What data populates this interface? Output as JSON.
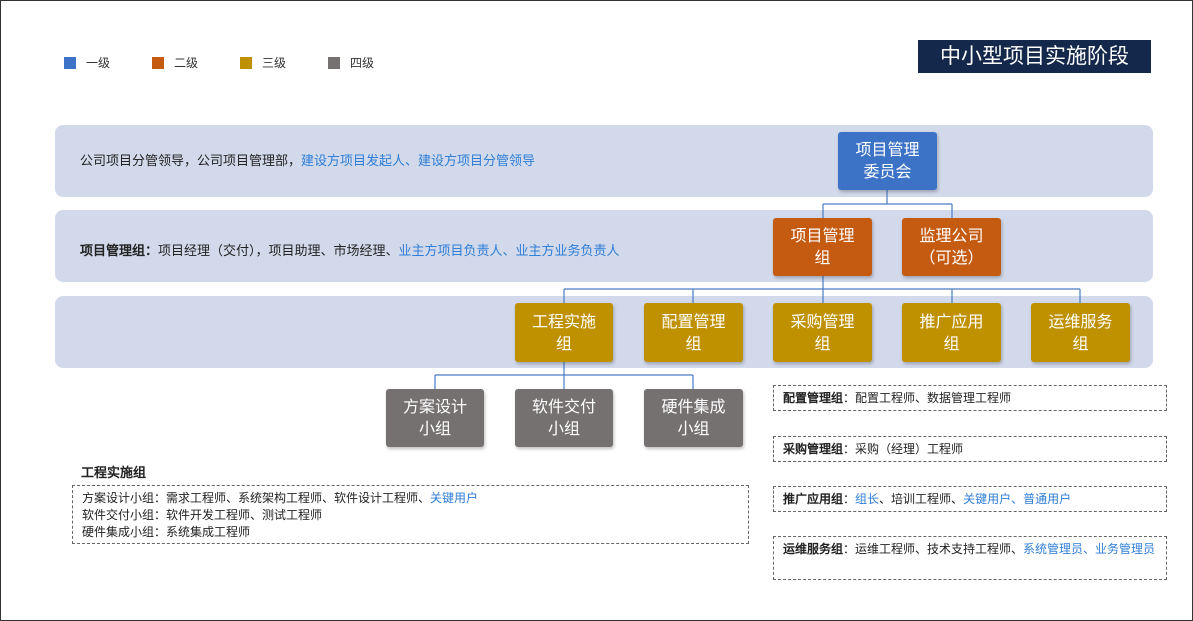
{
  "title": "中小型项目实施阶段",
  "legend": [
    {
      "label": "一级",
      "color": "#3d73c7"
    },
    {
      "label": "二级",
      "color": "#c55a11"
    },
    {
      "label": "三级",
      "color": "#bf9000"
    },
    {
      "label": "四级",
      "color": "#757171"
    }
  ],
  "bands": {
    "row1": {
      "text_black": "公司项目分管领导，公司项目管理部，",
      "text_blue": "建设方项目发起人、建设方项目分管领导"
    },
    "row2": {
      "label": "项目管理组：",
      "text_black": "项目经理（交付），项目助理、市场经理、",
      "text_blue": "业主方项目负责人、业主方业务负责人"
    }
  },
  "nodes": {
    "committee": {
      "line1": "项目管理",
      "line2": "委员会"
    },
    "pm_group": {
      "line1": "项目管理",
      "line2": "组"
    },
    "supervisor": {
      "line1": "监理公司",
      "line2": "（可选）"
    },
    "engineering": {
      "line1": "工程实施",
      "line2": "组"
    },
    "config": {
      "line1": "配置管理",
      "line2": "组"
    },
    "purchase": {
      "line1": "采购管理",
      "line2": "组"
    },
    "promotion": {
      "line1": "推广应用",
      "line2": "组"
    },
    "ops": {
      "line1": "运维服务",
      "line2": "组"
    },
    "design": {
      "line1": "方案设计",
      "line2": "小组"
    },
    "software": {
      "line1": "软件交付",
      "line2": "小组"
    },
    "hardware": {
      "line1": "硬件集成",
      "line2": "小组"
    }
  },
  "engineering_group": {
    "title": "工程实施组",
    "lines": [
      {
        "black": "方案设计小组：需求工程师、系统架构工程师、软件设计工程师、",
        "blue": "关键用户"
      },
      {
        "black": "软件交付小组：软件开发工程师、测试工程师",
        "blue": ""
      },
      {
        "black": "硬件集成小组：系统集成工程师",
        "blue": ""
      }
    ]
  },
  "group_notes": {
    "config": {
      "label": "配置管理组",
      "text_black": "：配置工程师、数据管理工程师",
      "text_blue": ""
    },
    "purchase": {
      "label": "采购管理组",
      "text_black": "：采购（经理）工程师",
      "text_blue": ""
    },
    "promotion": {
      "label": "推广应用组",
      "text_black": "：",
      "text_blue": "组长",
      "text_black2": "、培训工程师、",
      "text_blue2": "关键用户、普通用户"
    },
    "ops": {
      "label": "运维服务组",
      "text_black": "：运维工程师、技术支持工程师、",
      "text_blue": "系统管理员、业务管理员"
    }
  }
}
